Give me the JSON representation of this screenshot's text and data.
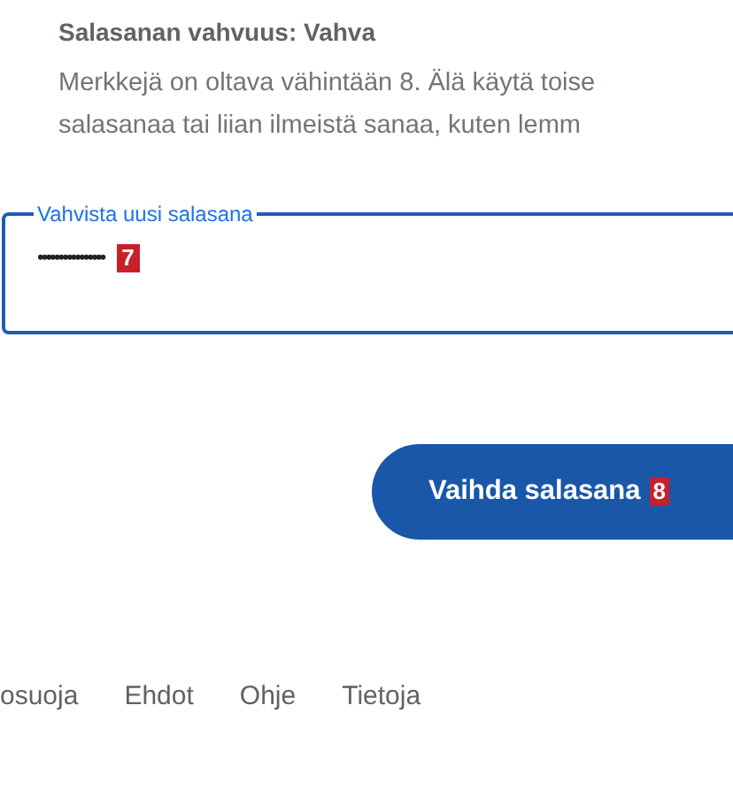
{
  "strength": {
    "title": "Salasanan vahvuus: Vahva",
    "hint_lines": [
      "Merkkejä on oltava vähintään 8. Älä käytä toise",
      "salasanaa tai liian ilmeistä sanaa, kuten lemm"
    ]
  },
  "confirm_field": {
    "label": "Vahvista uusi salasana",
    "value": "••••••••••••••••",
    "badge": "7"
  },
  "submit": {
    "label": "Vaihda salasana",
    "badge": "8"
  },
  "footer_links": [
    "osuoja",
    "Ehdot",
    "Ohje",
    "Tietoja"
  ]
}
